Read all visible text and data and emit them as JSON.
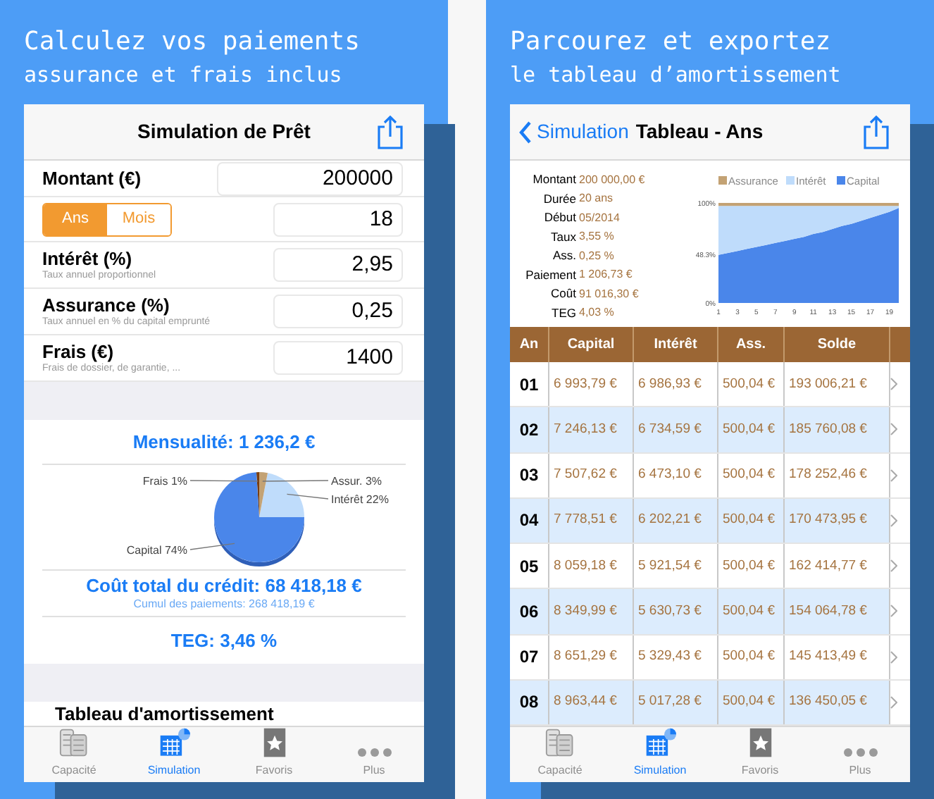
{
  "simulation_screen": {
    "headline": "Calculez vos paiements",
    "subheadline": "assurance et frais inclus",
    "nav_title": "Simulation de Prêt",
    "fields": [
      {
        "kind": "input",
        "label": "Montant (€)",
        "value": "200000"
      },
      {
        "kind": "segmented",
        "segments": [
          {
            "label": "Ans",
            "selected": true
          },
          {
            "label": "Mois",
            "selected": false
          }
        ],
        "value": "18"
      },
      {
        "kind": "input",
        "label": "Intérêt (%)",
        "hint": "Taux annuel proportionnel",
        "value": "2,95"
      },
      {
        "kind": "input",
        "label": "Assurance (%)",
        "hint": "Taux annuel en % du capital emprunté",
        "value": "0,25"
      },
      {
        "kind": "input",
        "label": "Frais (€)",
        "hint": "Frais de dossier, de garantie, ...",
        "value": "1400"
      }
    ],
    "monthly_payment": "Mensualité: 1 236,2 €",
    "chart_data": {
      "type": "pie",
      "categories": [
        "Intérêt",
        "Assur.",
        "Frais",
        "Capital"
      ],
      "values": [
        22,
        3,
        1,
        74
      ],
      "value_labels": [
        "22%",
        "3%",
        "1%",
        "74%"
      ],
      "data_labels": true,
      "colors": [
        "#bfdcfb",
        "#c3a274",
        "#7a3e10",
        "#4a86ea"
      ]
    },
    "total_cost": "Coût total du crédit: 68 418,18 €",
    "cumulative_payments": "Cumul des paiements: 268 418,19 €",
    "teg": "TEG: 3,46 %",
    "table_link": "Tableau d'amortissement",
    "tab_bar": [
      {
        "label": "Capacité",
        "selected": false
      },
      {
        "label": "Simulation",
        "selected": true
      },
      {
        "label": "Favoris",
        "selected": false
      },
      {
        "label": "Plus",
        "selected": false
      }
    ]
  },
  "table_screen": {
    "headline": "Parcourez et exportez",
    "subheadline": "le tableau d’amortissement",
    "back": "Simulation",
    "nav_title": "Tableau - Ans",
    "summary": [
      {
        "label": "Montant",
        "value": "200 000,00 €"
      },
      {
        "label": "Durée",
        "value": "20 ans"
      },
      {
        "label": "Début",
        "value": "05/2014"
      },
      {
        "label": "Taux",
        "value": "3,55 %"
      },
      {
        "label": "Ass.",
        "value": "0,25 %"
      },
      {
        "label": "Paiement",
        "value": "1 206,73 €"
      },
      {
        "label": "Coût",
        "value": "91 016,30 €"
      },
      {
        "label": "TEG",
        "value": "4,03 %"
      }
    ],
    "chart_data": {
      "type": "area",
      "stacked": true,
      "x": [
        1,
        2,
        3,
        4,
        5,
        6,
        7,
        8,
        9,
        10,
        11,
        12,
        13,
        14,
        15,
        16,
        17,
        18,
        19,
        20
      ],
      "legend": "top",
      "xticks": [
        1,
        3,
        5,
        7,
        9,
        11,
        13,
        15,
        17,
        19
      ],
      "xlim": [
        1,
        20
      ],
      "ylim": [
        0,
        100
      ],
      "yticks": [
        {
          "value": 0,
          "label": "0%"
        },
        {
          "value": 48.3,
          "label": "48.3%"
        },
        {
          "value": 100,
          "label": "100%"
        }
      ],
      "series": [
        {
          "name": "Capital",
          "color": "#4a86ea",
          "values": [
            48,
            50,
            52,
            54,
            56,
            58,
            60,
            62,
            64,
            66,
            69,
            71,
            74,
            77,
            79,
            82,
            85,
            88,
            91,
            95
          ]
        },
        {
          "name": "Intérêt",
          "color": "#bfdcfb",
          "values": [
            49,
            47,
            45,
            43,
            41,
            39,
            37,
            35,
            33,
            31,
            28,
            26,
            23,
            20,
            18,
            15,
            12,
            9,
            6,
            2
          ]
        },
        {
          "name": "Assurance",
          "color": "#c3a274",
          "values": [
            3,
            3,
            3,
            3,
            3,
            3,
            3,
            3,
            3,
            3,
            3,
            3,
            3,
            3,
            3,
            3,
            3,
            3,
            3,
            3
          ]
        }
      ]
    },
    "table": {
      "columns": [
        "An",
        "Capital",
        "Intérêt",
        "Ass.",
        "Solde"
      ],
      "rows": [
        [
          "01",
          "6 993,79 €",
          "6 986,93 €",
          "500,04 €",
          "193 006,21 €"
        ],
        [
          "02",
          "7 246,13 €",
          "6 734,59 €",
          "500,04 €",
          "185 760,08 €"
        ],
        [
          "03",
          "7 507,62 €",
          "6 473,10 €",
          "500,04 €",
          "178 252,46 €"
        ],
        [
          "04",
          "7 778,51 €",
          "6 202,21 €",
          "500,04 €",
          "170 473,95 €"
        ],
        [
          "05",
          "8 059,18 €",
          "5 921,54 €",
          "500,04 €",
          "162 414,77 €"
        ],
        [
          "06",
          "8 349,99 €",
          "5 630,73 €",
          "500,04 €",
          "154 064,78 €"
        ],
        [
          "07",
          "8 651,29 €",
          "5 329,43 €",
          "500,04 €",
          "145 413,49 €"
        ],
        [
          "08",
          "8 963,44 €",
          "5 017,28 €",
          "500,04 €",
          "136 450,05 €"
        ]
      ]
    },
    "tab_bar": [
      {
        "label": "Capacité",
        "selected": false
      },
      {
        "label": "Simulation",
        "selected": true
      },
      {
        "label": "Favoris",
        "selected": false
      },
      {
        "label": "Plus",
        "selected": false
      }
    ]
  }
}
